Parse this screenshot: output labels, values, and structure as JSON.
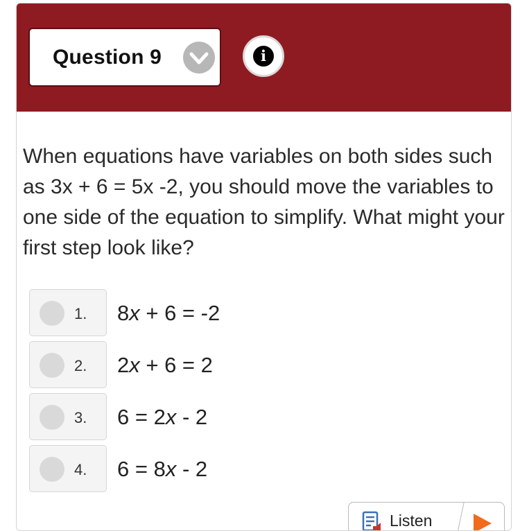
{
  "header": {
    "question_label": "Question 9",
    "chevron_icon": "chevron-down-icon",
    "info_icon": "info-icon",
    "info_glyph": "i",
    "accent_color": "#8e1b21"
  },
  "question": {
    "prompt": "When equations have variables on both sides such as 3x + 6 = 5x -2, you should move the variables to one side of the equation to simplify. What might your first step look like?"
  },
  "choices": [
    {
      "number": "1.",
      "text": "8x + 6 = -2",
      "selected": false
    },
    {
      "number": "2.",
      "text": "2x + 6 = 2",
      "selected": false
    },
    {
      "number": "3.",
      "text": "6 = 2x - 2",
      "selected": false
    },
    {
      "number": "4.",
      "text": "6 = 8x - 2",
      "selected": false
    }
  ],
  "toolbar": {
    "listen_label": "Listen",
    "listen_icon": "document-audio-icon",
    "play_icon": "play-icon",
    "play_color": "#f26a1b"
  }
}
